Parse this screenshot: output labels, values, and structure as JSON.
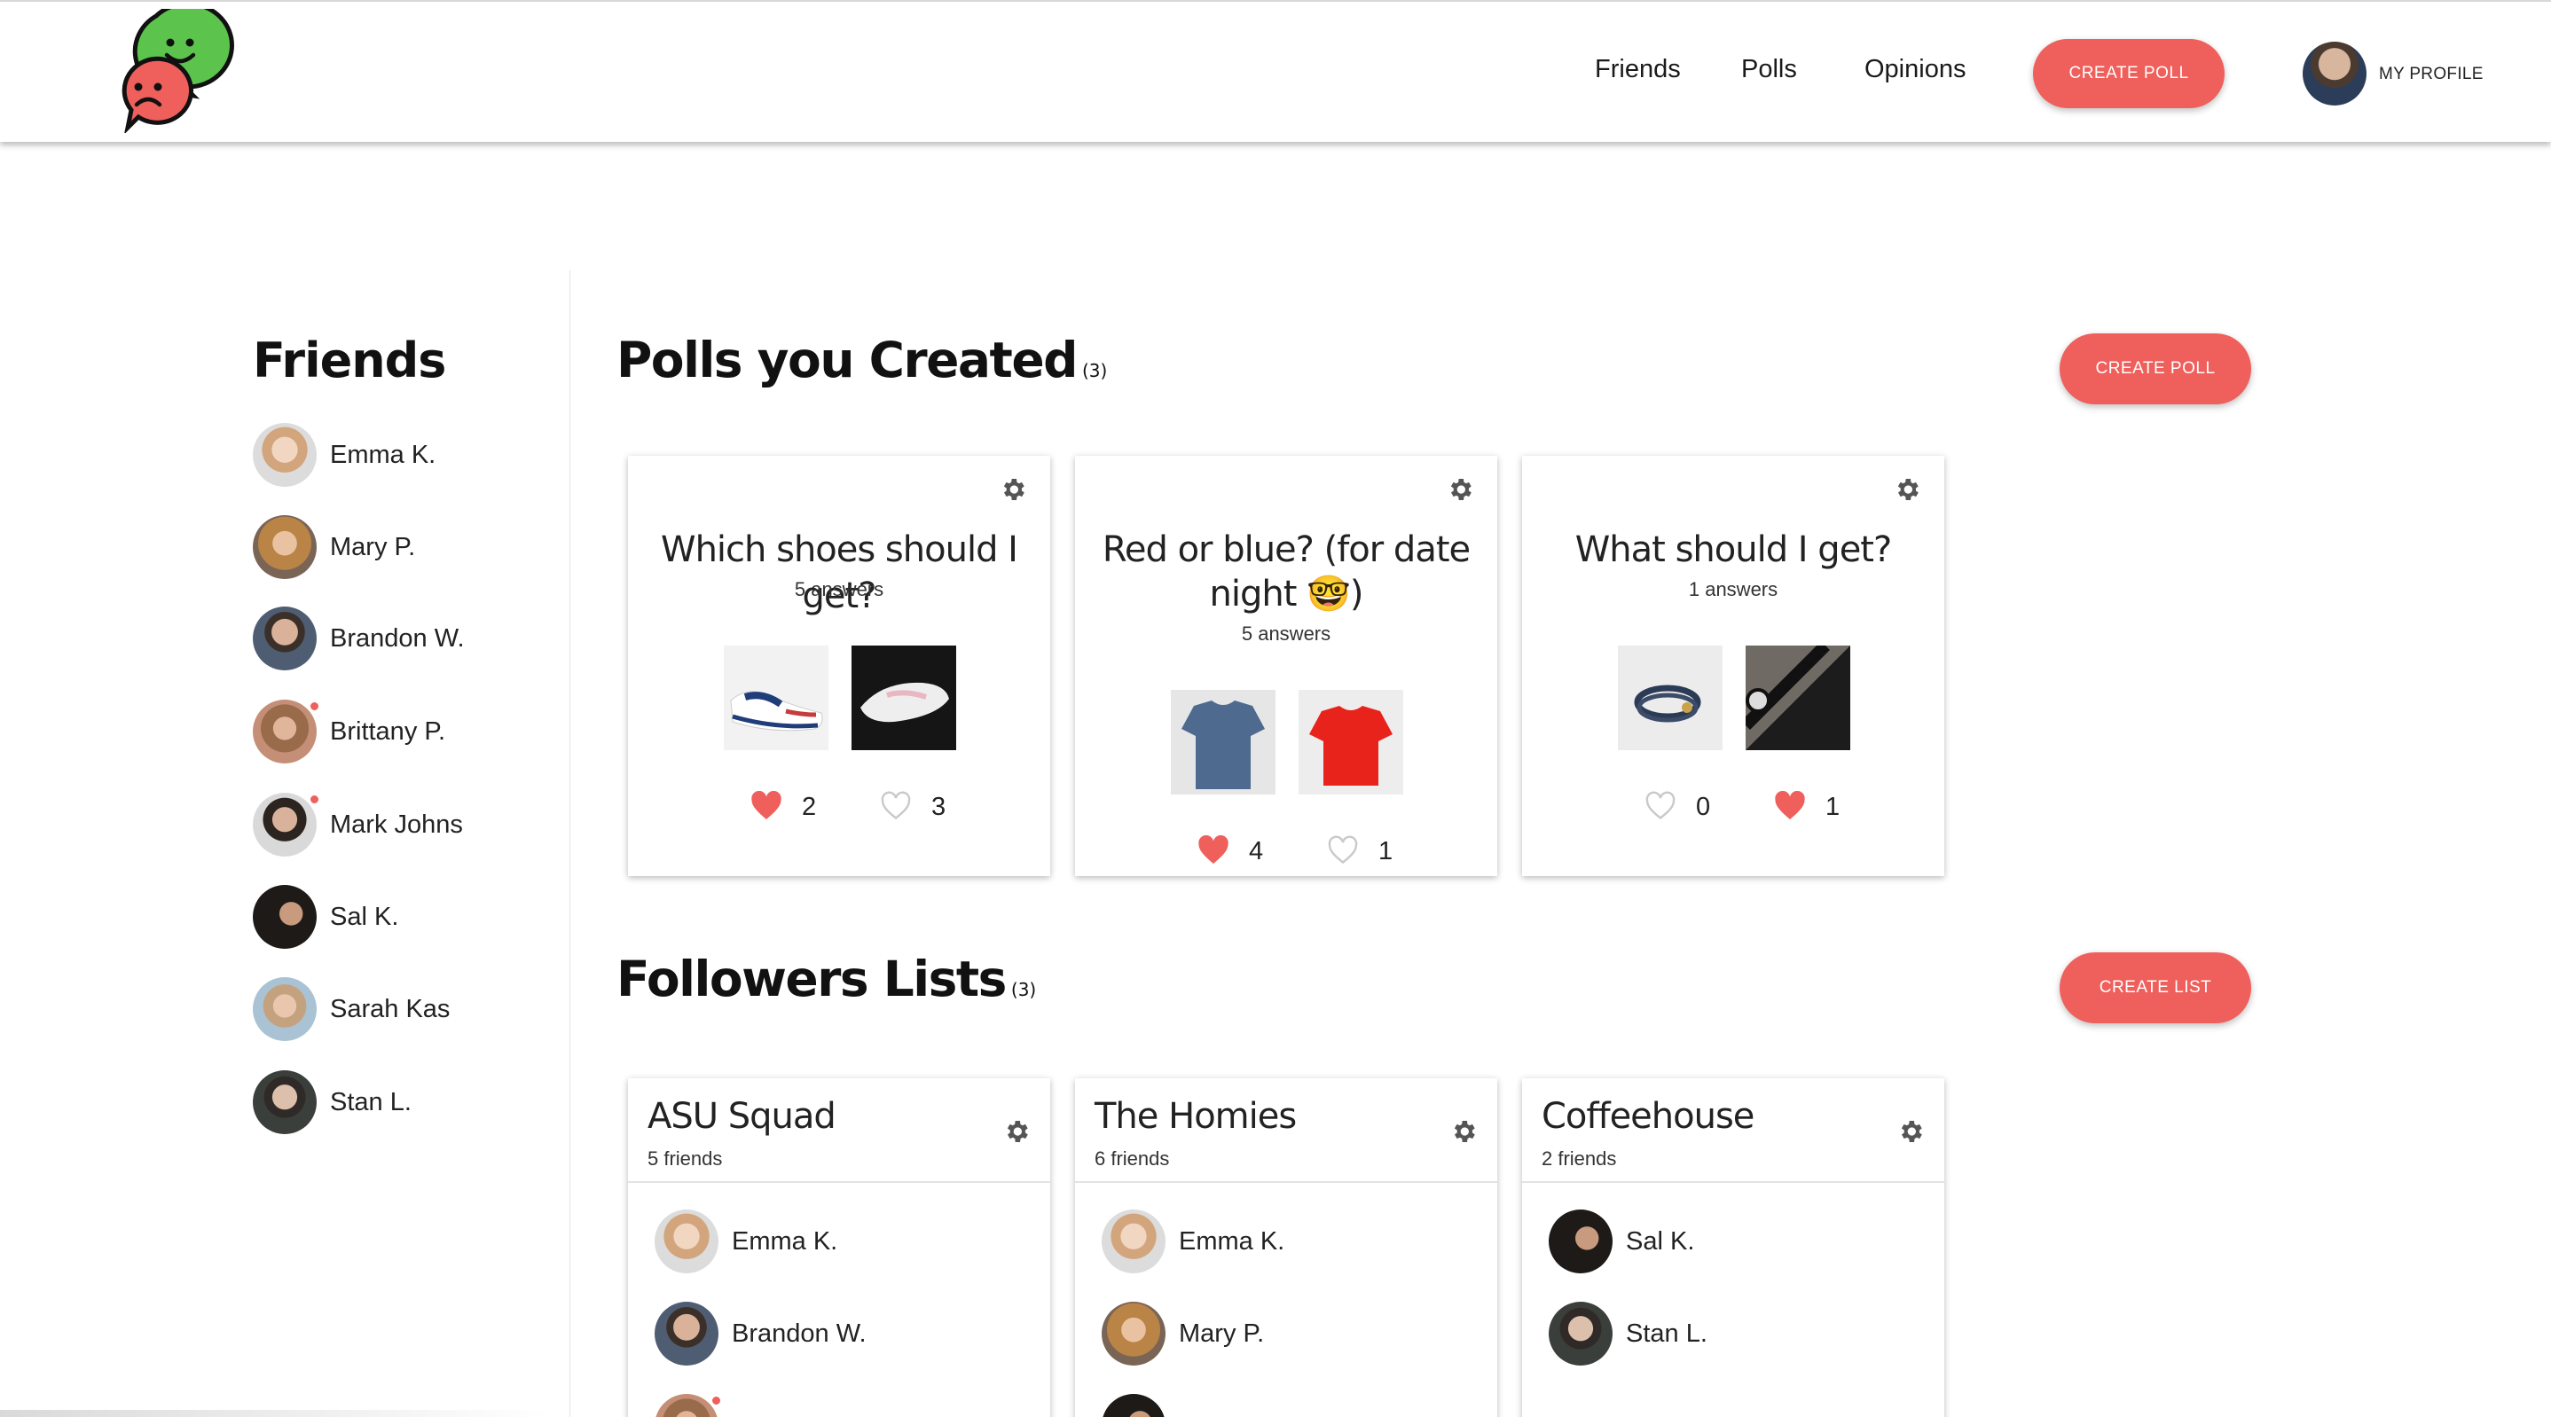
{
  "header": {
    "nav": [
      "Friends",
      "Polls",
      "Opinions"
    ],
    "create_poll": "CREATE POLL",
    "profile": "MY PROFILE"
  },
  "sidebar": {
    "title": "Friends",
    "friends": [
      {
        "name": "Emma K.",
        "notify": false
      },
      {
        "name": "Mary P.",
        "notify": false
      },
      {
        "name": "Brandon W.",
        "notify": false
      },
      {
        "name": "Brittany P.",
        "notify": true
      },
      {
        "name": "Mark Johns",
        "notify": true
      },
      {
        "name": "Sal K.",
        "notify": false
      },
      {
        "name": "Sarah Kas",
        "notify": false
      },
      {
        "name": "Stan L.",
        "notify": false
      }
    ]
  },
  "polls": {
    "title": "Polls you Created",
    "count": "(3)",
    "create_button": "CREATE POLL",
    "items": [
      {
        "question": "Which shoes should I get?",
        "answers": "5 answers",
        "votes": [
          {
            "liked": true,
            "count": "2"
          },
          {
            "liked": false,
            "count": "3"
          }
        ]
      },
      {
        "question_line1": "Red or blue? (for date",
        "question_line2": "night 🤓)",
        "answers": "5 answers",
        "votes": [
          {
            "liked": true,
            "count": "4"
          },
          {
            "liked": false,
            "count": "1"
          }
        ]
      },
      {
        "question": "What should I get?",
        "answers": "1 answers",
        "votes": [
          {
            "liked": false,
            "count": "0"
          },
          {
            "liked": true,
            "count": "1"
          }
        ]
      }
    ]
  },
  "lists": {
    "title": "Followers Lists",
    "count": "(3)",
    "create_button": "CREATE LIST",
    "items": [
      {
        "name": "ASU Squad",
        "sub": "5 friends",
        "members": [
          "Emma K.",
          "Brandon W."
        ]
      },
      {
        "name": "The Homies",
        "sub": "6 friends",
        "members": [
          "Emma K.",
          "Mary P."
        ]
      },
      {
        "name": "Coffeehouse",
        "sub": "2 friends",
        "members": [
          "Sal K.",
          "Stan L."
        ]
      }
    ]
  },
  "colors": {
    "accent": "#ef5f5c",
    "logo_green": "#5cc44d",
    "logo_red": "#ef5f5c"
  }
}
